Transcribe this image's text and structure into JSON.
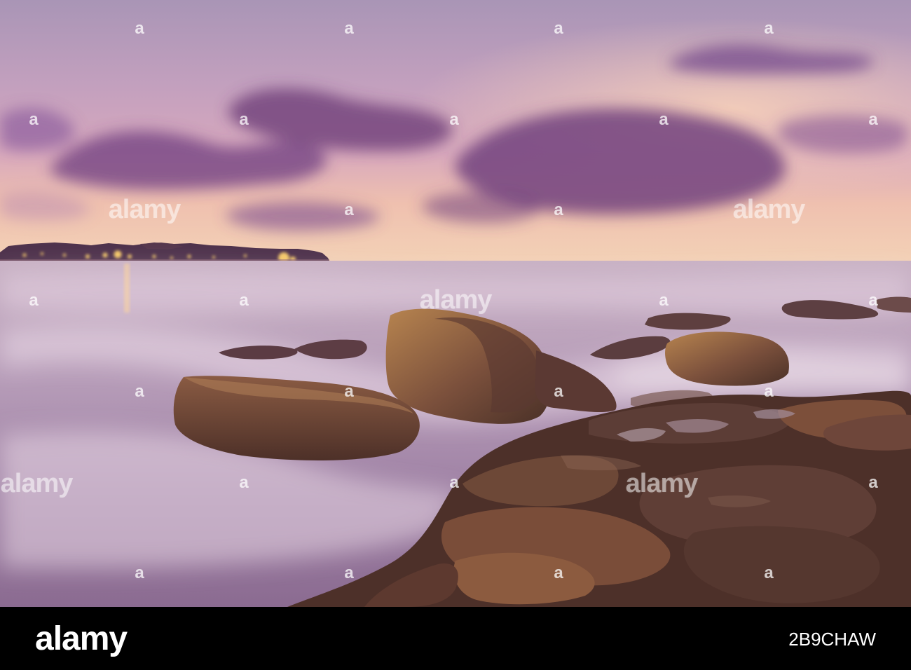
{
  "image": {
    "description_alt": "",
    "colors": {
      "sky_top": "#b7a2c4",
      "sky_mid": "#c59ab4",
      "sky_horizon": "#f2c9a9",
      "cloud": "#7d4f8b",
      "sea": "#cbb6c7",
      "mist": "#ead7e5",
      "rock": "#6f4637",
      "rock_light": "#9a6a48",
      "town_lights": "#ffd16a",
      "footer_bg": "#000000"
    }
  },
  "watermark": {
    "brand": "alamy",
    "short": "a"
  },
  "footer": {
    "logo": "alamy",
    "image_id": "2B9CHAW"
  }
}
